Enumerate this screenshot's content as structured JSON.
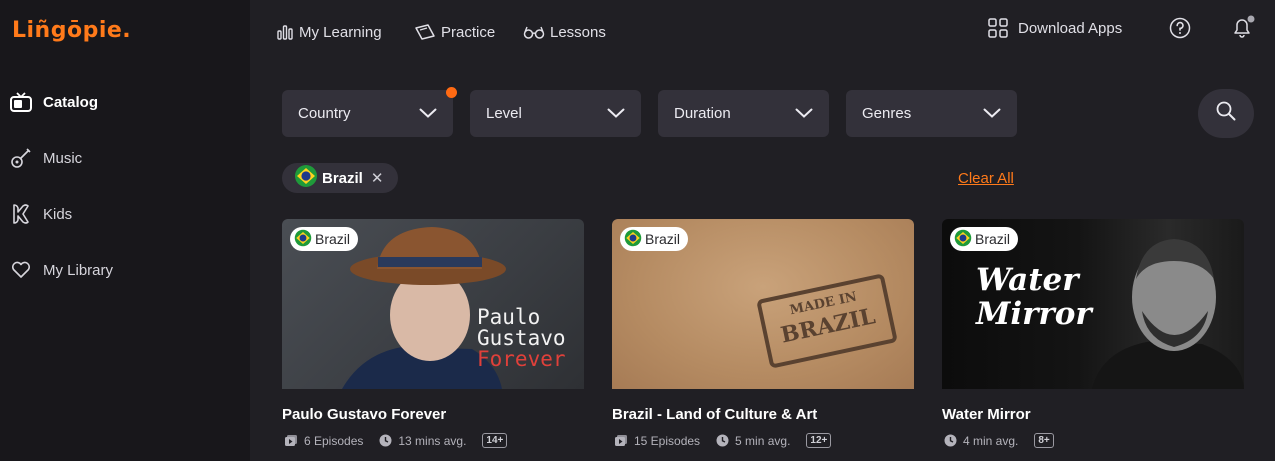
{
  "app": {
    "logo": "Liñgōpie."
  },
  "sidebar": {
    "items": [
      {
        "label": "Catalog",
        "icon": "tv-icon",
        "active": true
      },
      {
        "label": "Music",
        "icon": "guitar-icon"
      },
      {
        "label": "Kids",
        "icon": "kids-icon"
      },
      {
        "label": "My Library",
        "icon": "heart-icon"
      }
    ]
  },
  "topnav": {
    "my_learning": "My Learning",
    "practice": "Practice",
    "lessons": "Lessons",
    "download_apps": "Download Apps"
  },
  "filters": {
    "country": "Country",
    "level": "Level",
    "duration": "Duration",
    "genres": "Genres"
  },
  "active_filter": {
    "label": "Brazil"
  },
  "clear_all": "Clear All",
  "cards": [
    {
      "badge": "Brazil",
      "title": "Paulo Gustavo Forever",
      "episodes": "6 Episodes",
      "duration": "13 mins avg.",
      "age": "14+",
      "thumb_line1": "Paulo",
      "thumb_line2": "Gustavo",
      "thumb_line3": "Forever"
    },
    {
      "badge": "Brazil",
      "title": "Brazil - Land of Culture & Art",
      "episodes": "15 Episodes",
      "duration": "5 min avg.",
      "age": "12+",
      "stamp_line1": "MADE IN",
      "stamp_line2": "BRAZIL"
    },
    {
      "badge": "Brazil",
      "title": "Water Mirror",
      "duration": "4 min avg.",
      "age": "8+",
      "thumb_line1": "Water",
      "thumb_line2": "Mirror"
    }
  ],
  "colors": {
    "accent": "#ff7a1a",
    "bg": "#201f24",
    "sidebar": "#18171b",
    "control": "#33313a"
  }
}
